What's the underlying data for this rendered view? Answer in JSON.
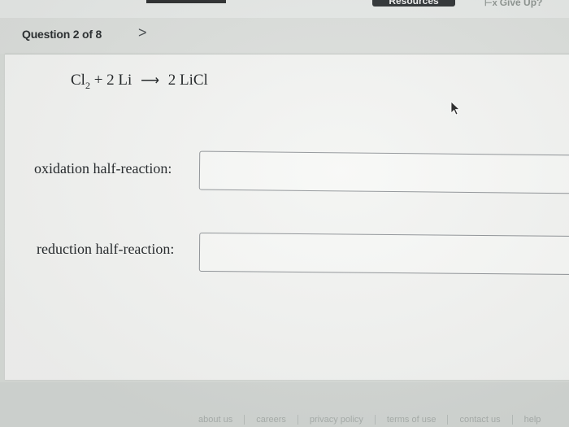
{
  "topbar": {
    "resources_label": "Resources",
    "give_up_label": "Give Up?",
    "give_up_icon": "x-icon"
  },
  "question": {
    "label": "Question 2 of 8",
    "next_icon": "chevron-right-icon"
  },
  "equation": {
    "reactant1": "Cl",
    "reactant1_sub": "2",
    "plus": "+ 2 Li",
    "product": "2 LiCl"
  },
  "fields": {
    "oxidation_label": "oxidation half-reaction:",
    "oxidation_value": "",
    "reduction_label": "reduction half-reaction:",
    "reduction_value": ""
  },
  "footer": {
    "links": [
      "about us",
      "careers",
      "privacy policy",
      "terms of use",
      "contact us",
      "help"
    ]
  }
}
